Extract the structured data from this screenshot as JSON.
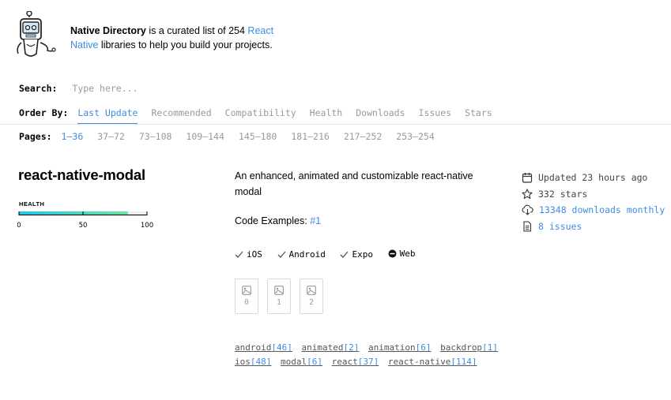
{
  "intro": {
    "brand": "Native Directory",
    "text_middle": " is a curated list of 254 ",
    "link_react": "React",
    "link_native": "Native",
    "text_end": " libraries to help you build your projects."
  },
  "search": {
    "label": "Search:",
    "placeholder": "Type here..."
  },
  "order": {
    "label": "Order By:",
    "options": [
      "Last Update",
      "Recommended",
      "Compatibility",
      "Health",
      "Downloads",
      "Issues",
      "Stars"
    ]
  },
  "pages": {
    "label": "Pages:",
    "items": [
      "1–36",
      "37–72",
      "73–108",
      "109–144",
      "145–180",
      "181–216",
      "217–252",
      "253–254"
    ]
  },
  "library": {
    "name": "react-native-modal",
    "health_label": "HEALTH",
    "health_value": 85,
    "health_ticks": [
      "0",
      "50",
      "100"
    ],
    "description": "An enhanced, animated and customizable react-native modal",
    "code_examples_label": "Code Examples: ",
    "code_examples_link": "#1",
    "platforms": [
      {
        "name": "iOS",
        "icon": "check-icon"
      },
      {
        "name": "Android",
        "icon": "check-icon"
      },
      {
        "name": "Expo",
        "icon": "check-icon"
      },
      {
        "name": "Web",
        "icon": "minus-circle-icon"
      }
    ],
    "images": [
      "0",
      "1",
      "2"
    ],
    "topics_row1": [
      {
        "name": "android",
        "count": "[46]"
      },
      {
        "name": "animated",
        "count": "[2]"
      },
      {
        "name": "animation",
        "count": "[6]"
      },
      {
        "name": "backdrop",
        "count": "[1]"
      }
    ],
    "topics_row2": [
      {
        "name": "ios",
        "count": "[48]"
      },
      {
        "name": "modal",
        "count": "[6]"
      },
      {
        "name": "react",
        "count": "[37]"
      },
      {
        "name": "react-native",
        "count": "[114]"
      }
    ],
    "meta": {
      "updated": "Updated 23 hours ago",
      "stars": "332 stars",
      "downloads": "13348 downloads monthly",
      "issues": "8 issues"
    }
  },
  "colors": {
    "accent": "#3f8ce5",
    "health_gradient_start": "#22c5e8",
    "health_gradient_end": "#6ee3a2"
  }
}
